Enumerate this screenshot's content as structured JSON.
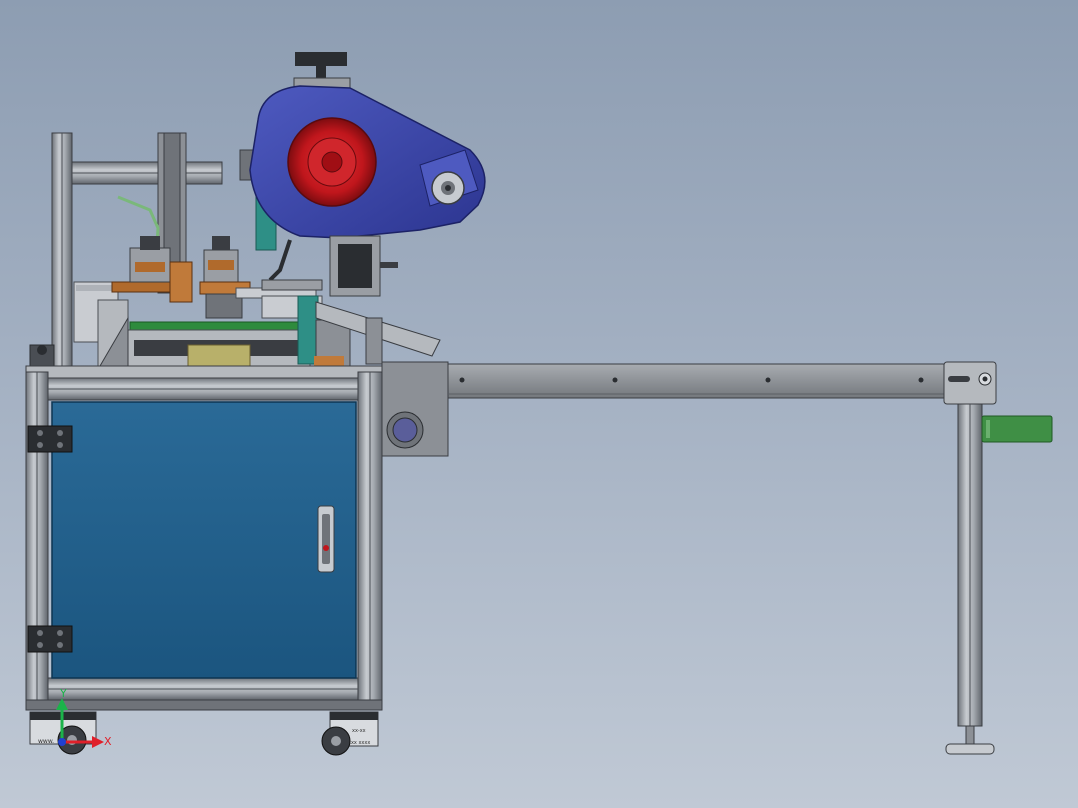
{
  "viewport": {
    "background_top": "#8d9db2",
    "background_bottom": "#c0c9d5"
  },
  "colors": {
    "frame_aluminum": "#9aa0a8",
    "frame_dark": "#5a5f66",
    "cabinet_panel": "#1f5f8c",
    "belt_cover": "#3c48a8",
    "reel_red": "#c0161c",
    "conveyor_arm": "#8b8f94",
    "green_handle": "#3f8f45",
    "pcb_green": "#2e8b3d",
    "copper": "#b06a2c",
    "teal_bracket": "#2e8f86"
  },
  "caster_labels": {
    "left": "www.",
    "right_top": "xx-xx",
    "right_bottom": "xxx xxxx"
  },
  "triad": {
    "x_label": "X",
    "y_label": "Y",
    "x_color": "#e0202a",
    "y_color": "#1bb34a",
    "z_color": "#2040d0"
  },
  "icons": [
    "triad-icon"
  ]
}
